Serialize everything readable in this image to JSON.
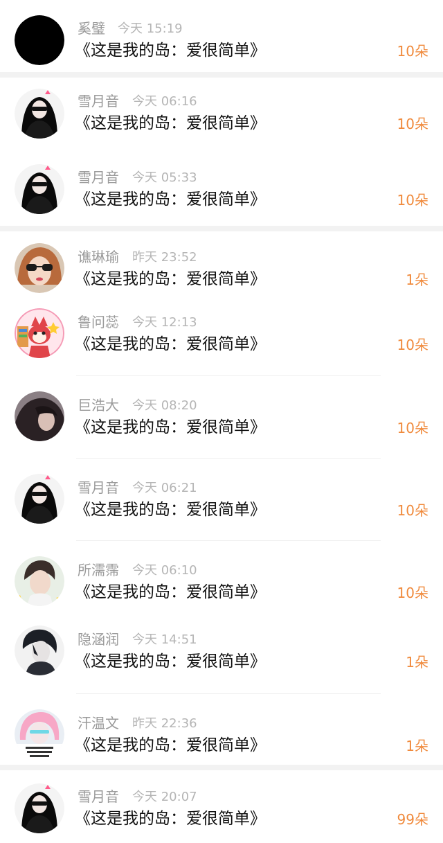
{
  "rows": [
    {
      "name": "奚璧",
      "time": "今天 15:19",
      "gift": "《这是我的岛：爱很简单》",
      "count": "10朵",
      "avatar": "black-circle"
    },
    {
      "name": "雪月音",
      "time": "今天 06:16",
      "gift": "《这是我的岛：爱很简单》",
      "count": "10朵",
      "avatar": "girl-sunglasses-black"
    },
    {
      "name": "雪月音",
      "time": "今天 05:33",
      "gift": "《这是我的岛：爱很简单》",
      "count": "10朵",
      "avatar": "girl-sunglasses-black"
    },
    {
      "name": "谯琳瑜",
      "time": "昨天 23:52",
      "gift": "《这是我的岛：爱很简单》",
      "count": "1朵",
      "avatar": "woman-sunglasses"
    },
    {
      "name": "鲁问蕊",
      "time": "今天 12:13",
      "gift": "《这是我的岛：爱很简单》",
      "count": "10朵",
      "avatar": "cartoon-fox"
    },
    {
      "name": "巨浩大",
      "time": "今天 08:20",
      "gift": "《这是我的岛：爱很简单》",
      "count": "10朵",
      "avatar": "girl-dark-hair"
    },
    {
      "name": "雪月音",
      "time": "今天 06:21",
      "gift": "《这是我的岛：爱很简单》",
      "count": "10朵",
      "avatar": "girl-sunglasses-black"
    },
    {
      "name": "所濡霈",
      "time": "今天 06:10",
      "gift": "《这是我的岛：爱很简单》",
      "count": "10朵",
      "avatar": "young-man"
    },
    {
      "name": "隐涵润",
      "time": "今天 14:51",
      "gift": "《这是我的岛：爱很简单》",
      "count": "1朵",
      "avatar": "anime-boy"
    },
    {
      "name": "汗温文",
      "time": "昨天 22:36",
      "gift": "《这是我的岛：爱很简单》",
      "count": "1朵",
      "avatar": "pink-hair-girl"
    },
    {
      "name": "雪月音",
      "time": "今天 20:07",
      "gift": "《这是我的岛：爱很简单》",
      "count": "99朵",
      "avatar": "girl-sunglasses-black"
    }
  ],
  "colors": {
    "count": "#f08a3c",
    "name": "#9a9a9a",
    "time": "#b5b5b5",
    "text": "#111111"
  }
}
